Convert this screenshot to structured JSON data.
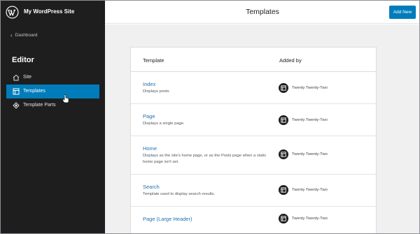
{
  "sidebar": {
    "site_title": "My WordPress Site",
    "back_label": "Dashboard",
    "heading": "Editor",
    "items": [
      {
        "label": "Site",
        "icon": "home-icon"
      },
      {
        "label": "Templates",
        "icon": "layout-icon",
        "active": true
      },
      {
        "label": "Template Parts",
        "icon": "symbol-icon"
      }
    ]
  },
  "header": {
    "title": "Templates",
    "add_new_label": "Add New"
  },
  "table": {
    "columns": [
      "Template",
      "Added by"
    ],
    "rows": [
      {
        "name": "Index",
        "description": "Displays posts.",
        "added_by": "Twenty Twenty-Two"
      },
      {
        "name": "Page",
        "description": "Displays a single page.",
        "added_by": "Twenty Twenty-Two"
      },
      {
        "name": "Home",
        "description": "Displays as the site's home page, or as the Posts page when a static home page isn't set.",
        "added_by": "Twenty Twenty-Two"
      },
      {
        "name": "Search",
        "description": "Template used to display search results.",
        "added_by": "Twenty Twenty-Two"
      },
      {
        "name": "Page (Large Header)",
        "description": "",
        "added_by": "Twenty Twenty-Two"
      }
    ]
  },
  "colors": {
    "sidebar_bg": "#1e1e1e",
    "accent": "#007cba",
    "link": "#2271b1",
    "main_bg": "#f0f0f0"
  }
}
